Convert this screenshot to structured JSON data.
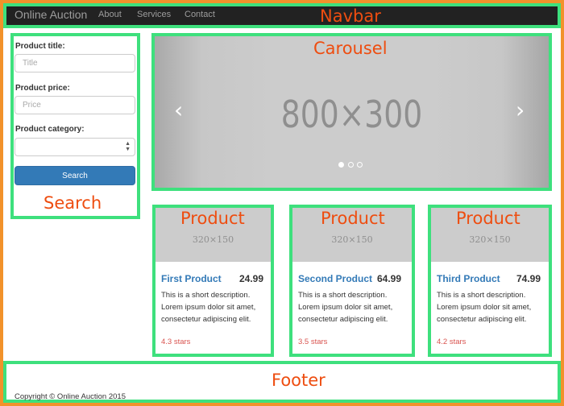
{
  "navbar": {
    "brand": "Online Auction",
    "links": [
      "About",
      "Services",
      "Contact"
    ],
    "zone_label": "Navbar"
  },
  "search": {
    "zone_label": "Search",
    "title_label": "Product title:",
    "title_placeholder": "Title",
    "price_label": "Product price:",
    "price_placeholder": "Price",
    "category_label": "Product category:",
    "category_value": "",
    "button_label": "Search"
  },
  "carousel": {
    "zone_label": "Carousel",
    "slide_text": "800×300",
    "prev_icon": "chevron-left-icon",
    "next_icon": "chevron-right-icon",
    "indicator_count": 3,
    "active_index": 0
  },
  "products": [
    {
      "zone_label": "Product",
      "thumb_text": "320×150",
      "title": "First Product",
      "price": "24.99",
      "description": "This is a short description. Lorem ipsum dolor sit amet, consectetur adipiscing elit.",
      "rating": "4.3 stars"
    },
    {
      "zone_label": "Product",
      "thumb_text": "320×150",
      "title": "Second Product",
      "price": "64.99",
      "description": "This is a short description. Lorem ipsum dolor sit amet, consectetur adipiscing elit.",
      "rating": "3.5 stars"
    },
    {
      "zone_label": "Product",
      "thumb_text": "320×150",
      "title": "Third Product",
      "price": "74.99",
      "description": "This is a short description. Lorem ipsum dolor sit amet, consectetur adipiscing elit.",
      "rating": "4.2 stars"
    }
  ],
  "footer": {
    "zone_label": "Footer",
    "copyright": "Copyright © Online Auction 2015"
  },
  "colors": {
    "frame_border": "#f2922b",
    "zone_border": "#3ee07d",
    "zone_label": "#ee4d10",
    "navbar_bg": "#222222",
    "primary": "#337ab7",
    "rating": "#d9534f"
  }
}
